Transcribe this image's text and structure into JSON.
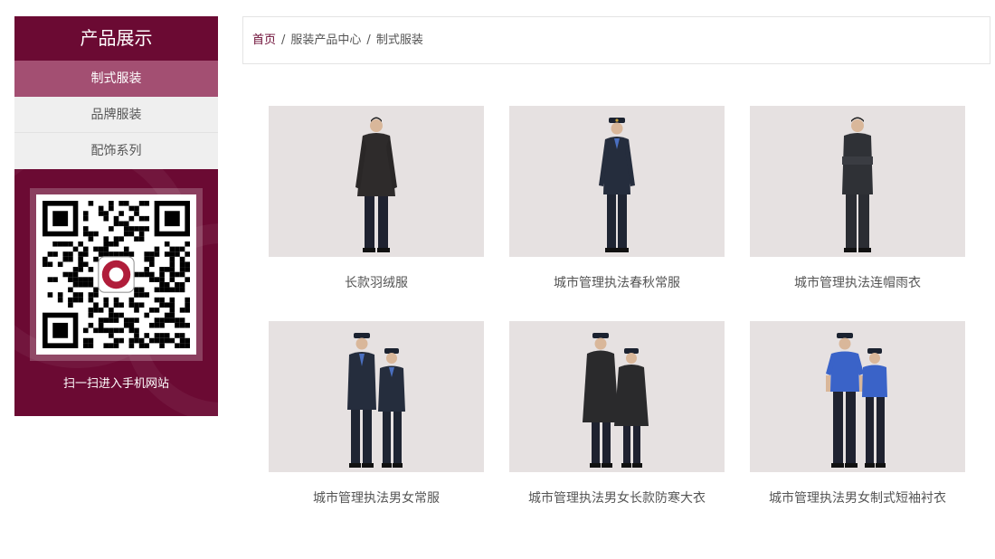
{
  "sidebar": {
    "title": "产品展示",
    "items": [
      {
        "label": "制式服装",
        "active": true
      },
      {
        "label": "品牌服装",
        "active": false
      },
      {
        "label": "配饰系列",
        "active": false
      }
    ],
    "qr_caption": "扫一扫进入手机网站"
  },
  "breadcrumb": {
    "home": "首页",
    "separator": "/",
    "level1": "服装产品中心",
    "level2": "制式服装"
  },
  "products": [
    {
      "name": "长款羽绒服"
    },
    {
      "name": "城市管理执法春秋常服"
    },
    {
      "name": "城市管理执法连帽雨衣"
    },
    {
      "name": "城市管理执法男女常服"
    },
    {
      "name": "城市管理执法男女长款防寒大衣"
    },
    {
      "name": "城市管理执法男女制式短袖衬衣"
    }
  ],
  "colors": {
    "brand": "#6b0a33",
    "active_item": "#a34f72",
    "photo_bg": "#e6e1e1",
    "uniform_dark": "#2b2f38",
    "shirt_blue": "#3a63c8"
  }
}
